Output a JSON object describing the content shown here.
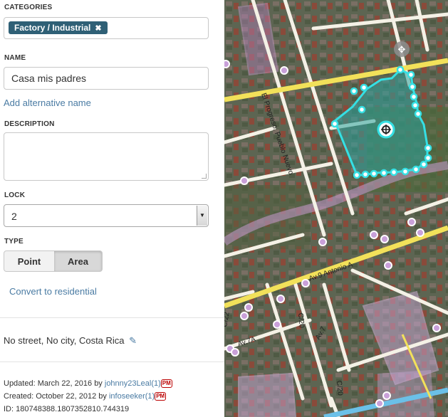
{
  "categories": {
    "label": "CATEGORIES",
    "tag": "Factory / Industrial",
    "remove_glyph": "✖"
  },
  "name": {
    "label": "NAME",
    "value": "Casa mis padres",
    "alt_link": "Add alternative name"
  },
  "description": {
    "label": "DESCRIPTION",
    "value": ""
  },
  "lock": {
    "label": "LOCK",
    "value": "2",
    "arrow": "▼"
  },
  "type": {
    "label": "TYPE",
    "options": [
      "Point",
      "Area"
    ],
    "selected": "Area"
  },
  "convert_link": "Convert to residential",
  "address": {
    "text": "No street, No city, Costa Rica",
    "edit_icon": "✎"
  },
  "meta": {
    "updated_prefix": "Updated: March 22, 2016 by ",
    "updated_user": "johnny23Leal(1)",
    "created_prefix": "Created: October 22, 2012 by ",
    "created_user": "infoseeker(1)",
    "pm": "PM",
    "id": "ID: 180748388.1807352810.744319"
  },
  "map": {
    "streets": [
      "El Progreso, Pueblo Nuevo",
      "Av.9 Antonio A",
      "Av.7",
      "Av.7A",
      "C/22",
      "C/20",
      "C/20"
    ],
    "move_icon": "✥"
  },
  "colors": {
    "tag_bg": "#2f6076",
    "link": "#4a7ba3",
    "area_fill": "#2aa39c",
    "area_stroke": "#35e0e4",
    "road": "#f2e15a"
  }
}
